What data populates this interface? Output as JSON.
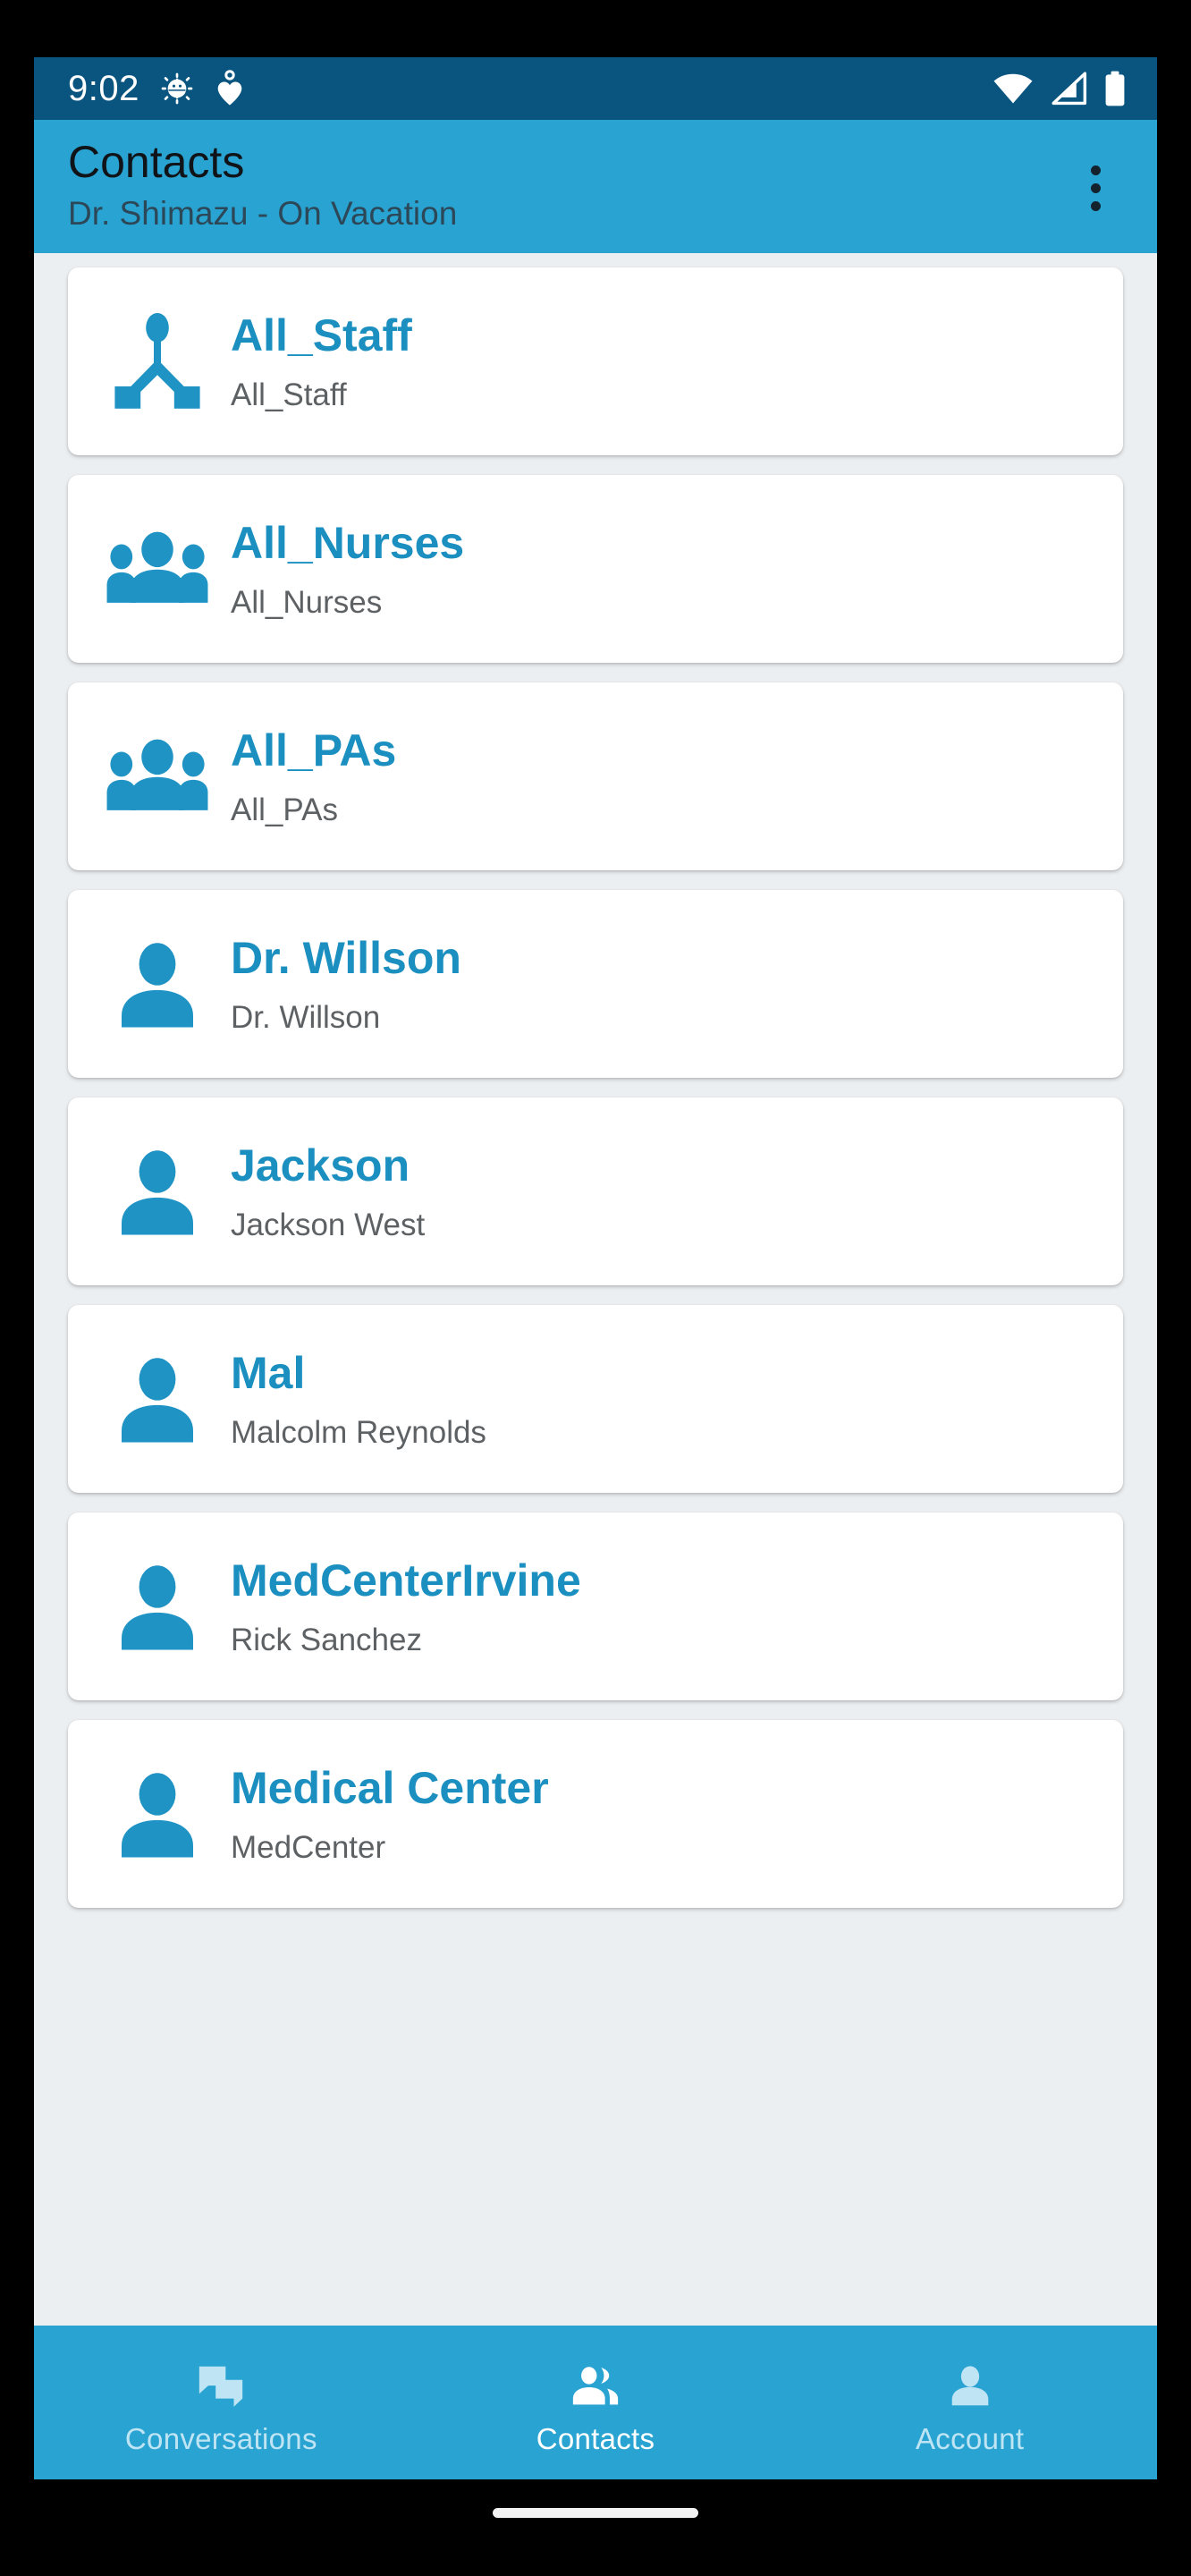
{
  "status_bar": {
    "time": "9:02",
    "icons_left": [
      "android-bug-icon",
      "heart-person-icon"
    ],
    "icons_right": [
      "wifi-icon",
      "cellular-signal-icon",
      "battery-icon"
    ],
    "background_color": "#0a5580"
  },
  "app_bar": {
    "title": "Contacts",
    "subtitle": "Dr. Shimazu - On Vacation",
    "overflow_icon": "more-vertical-icon",
    "background_color": "#29a4d2"
  },
  "contacts": [
    {
      "title": "All_Staff",
      "subtitle": "All_Staff",
      "avatar": "org-hierarchy-icon"
    },
    {
      "title": "All_Nurses",
      "subtitle": "All_Nurses",
      "avatar": "group-people-icon"
    },
    {
      "title": "All_PAs",
      "subtitle": "All_PAs",
      "avatar": "group-people-icon"
    },
    {
      "title": "Dr. Willson",
      "subtitle": "Dr. Willson",
      "avatar": "person-icon"
    },
    {
      "title": "Jackson",
      "subtitle": "Jackson West",
      "avatar": "person-icon"
    },
    {
      "title": "Mal",
      "subtitle": "Malcolm  Reynolds",
      "avatar": "person-icon"
    },
    {
      "title": "MedCenterIrvine",
      "subtitle": "Rick Sanchez",
      "avatar": "person-icon"
    },
    {
      "title": "Medical Center",
      "subtitle": "MedCenter",
      "avatar": "person-icon"
    }
  ],
  "bottom_nav": {
    "items": [
      {
        "label": "Conversations",
        "icon": "chat-bubbles-icon",
        "active": false
      },
      {
        "label": "Contacts",
        "icon": "people-icon",
        "active": true
      },
      {
        "label": "Account",
        "icon": "person-icon",
        "active": false
      }
    ],
    "background_color": "#29a4d2",
    "active_color": "#ffffff",
    "inactive_color": "#bfe4f4"
  },
  "theme": {
    "accent": "#1b8fc0",
    "primary": "#29a4d2",
    "status_bar_dark": "#0a5580",
    "page_background": "#eceff1",
    "card_background": "#ffffff",
    "subtitle_color": "#5d6164"
  }
}
